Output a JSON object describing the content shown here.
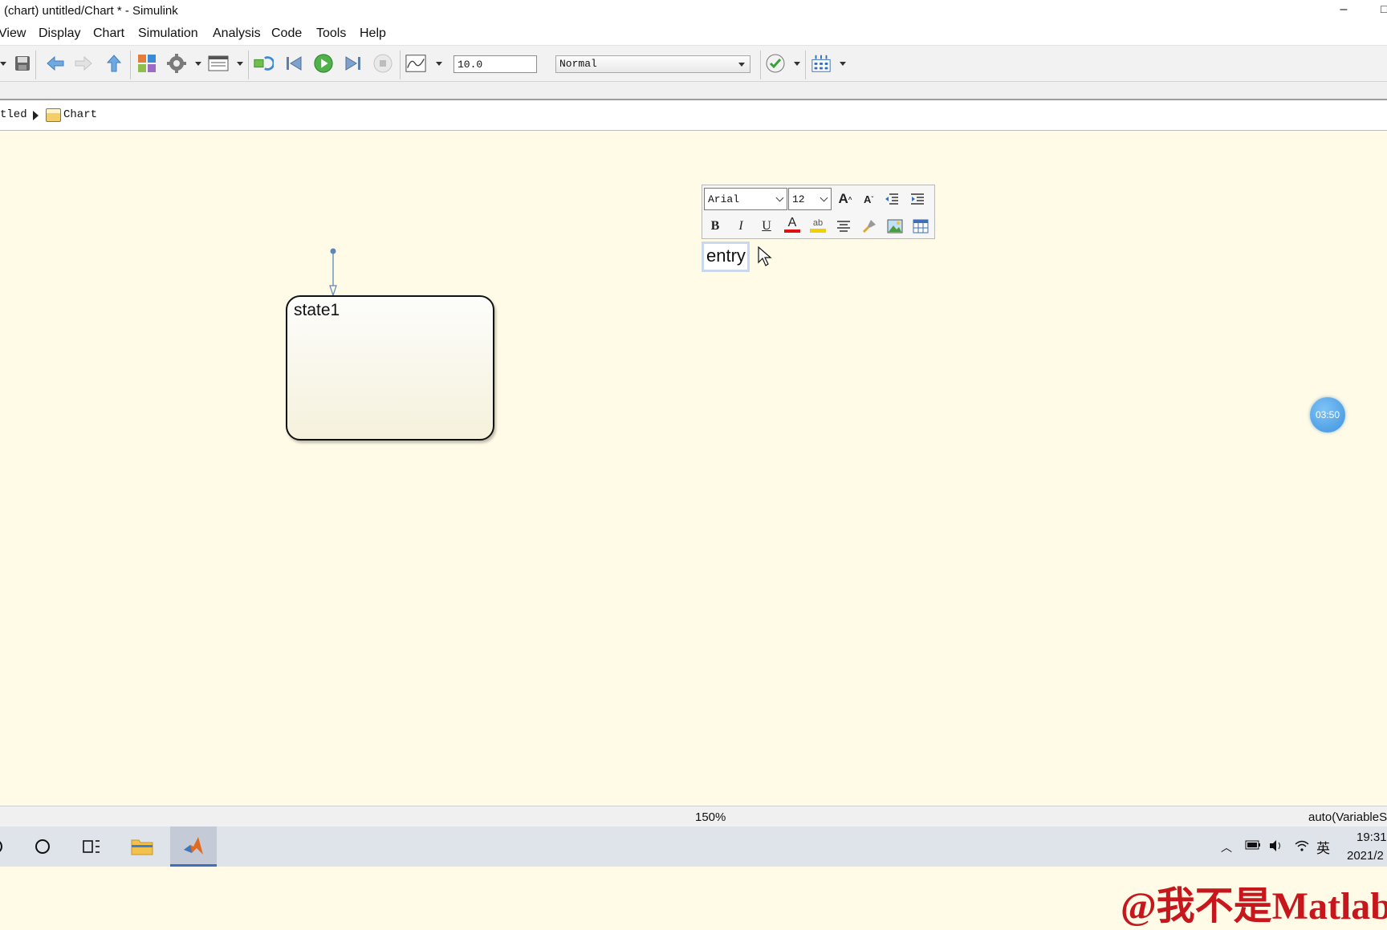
{
  "window": {
    "title": "(chart) untitled/Chart * - Simulink",
    "minimize_glyph": "–",
    "maximize_glyph": "□"
  },
  "menu": [
    "View",
    "Display",
    "Chart",
    "Simulation",
    "Analysis",
    "Code",
    "Tools",
    "Help"
  ],
  "toolbar": {
    "stop_time": "10.0",
    "sim_mode": "Normal",
    "icons": [
      "save-icon",
      "back-icon",
      "forward-icon",
      "up-icon",
      "library-browser-icon",
      "model-config-icon",
      "model-explorer-icon",
      "update-icon",
      "step-back-icon",
      "run-icon",
      "step-forward-icon",
      "stop-icon",
      "scope-icon",
      "check-icon",
      "debug-icon"
    ]
  },
  "breadcrumb": {
    "model": "tled",
    "chart": "Chart"
  },
  "canvas": {
    "state_label": "state1",
    "rich_text_toolbar": {
      "font": "Arial",
      "size": "12",
      "bold_label": "B",
      "italic_label": "I",
      "underline_label": "U",
      "grow_label": "A",
      "shrink_label": "A",
      "font_color_label": "A",
      "highlight_label": "ab"
    },
    "edit_text": "entry",
    "timer": "03:50",
    "watermark": "@我不是Matlab"
  },
  "status": {
    "zoom": "150%",
    "solver": "auto(VariableS"
  },
  "taskbar": {
    "ime": "英",
    "time": "19:31",
    "date": "2021/2"
  },
  "colors": {
    "canvas_bg": "#fffbe6",
    "watermark": "#c8161d",
    "run_green": "#3aa03a",
    "accent_blue": "#3a6fc4"
  }
}
